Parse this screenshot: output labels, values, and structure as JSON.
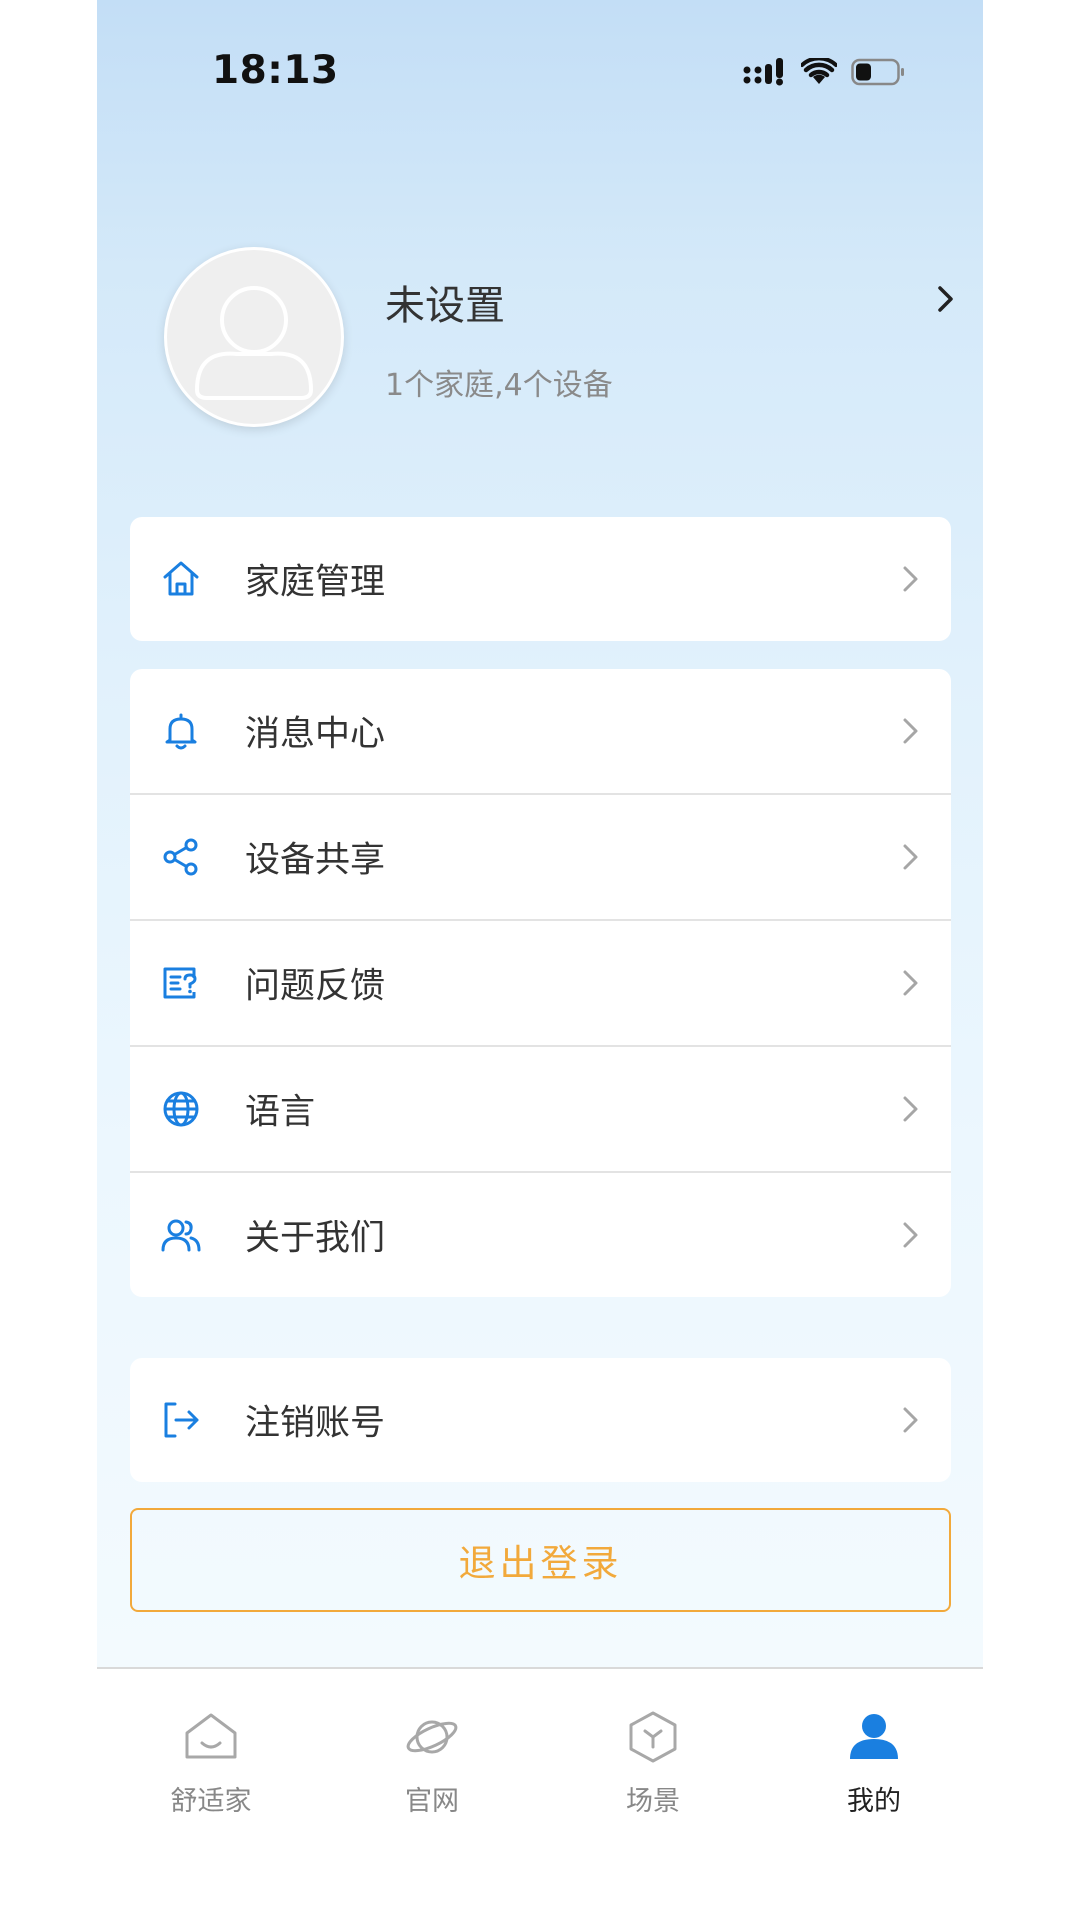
{
  "status_bar": {
    "time": "18:13"
  },
  "profile": {
    "name": "未设置",
    "summary": "1个家庭,4个设备"
  },
  "menu": {
    "home_management": "家庭管理",
    "group_main": [
      {
        "label": "消息中心",
        "icon": "bell-icon"
      },
      {
        "label": "设备共享",
        "icon": "share-icon"
      },
      {
        "label": "问题反馈",
        "icon": "feedback-icon"
      },
      {
        "label": "语言",
        "icon": "globe-icon"
      },
      {
        "label": "关于我们",
        "icon": "users-icon"
      }
    ],
    "delete_account": "注销账号"
  },
  "logout_label": "退出登录",
  "tabbar": {
    "items": [
      {
        "label": "舒适家",
        "icon": "home-smile-icon",
        "active": false
      },
      {
        "label": "官网",
        "icon": "planet-icon",
        "active": false
      },
      {
        "label": "场景",
        "icon": "cube-icon",
        "active": false
      },
      {
        "label": "我的",
        "icon": "person-icon",
        "active": true
      }
    ]
  },
  "colors": {
    "accent_blue": "#1a7fe0",
    "logout_orange": "#f2a93b",
    "tab_active": "#1a7fe0",
    "tab_inactive": "#a8a8a8"
  }
}
